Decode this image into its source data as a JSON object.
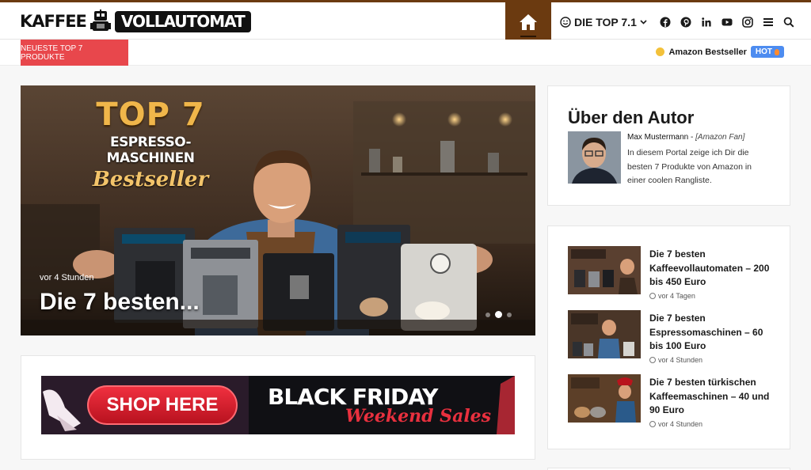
{
  "header": {
    "logo_word1": "KAFFEE",
    "logo_word2": "VOLLAUTOMAT",
    "accent_color": "#6b3a10",
    "menu_label": "DIE TOP 7.1",
    "social_icons": [
      "facebook-icon",
      "pinterest-icon",
      "linkedin-icon",
      "youtube-icon",
      "instagram-icon"
    ],
    "utility_icons": [
      "hamburger-menu-icon",
      "search-icon"
    ]
  },
  "ticker": {
    "label": "NEUESTE TOP 7 PRODUKTE",
    "label_color": "#e8474c",
    "item": "Amazon Bestseller",
    "badge": "HOT"
  },
  "hero": {
    "badge_top": "TOP 7",
    "badge_sub": "ESPRESSO-MASCHINEN",
    "badge_script": "Bestseller",
    "meta": "vor 4 Stunden",
    "title": "Die 7 besten...",
    "slides": 3,
    "active_slide": 2
  },
  "banner": {
    "shop": "SHOP HERE",
    "bf1": "BLACK FRIDAY",
    "bf2": "Weekend Sales"
  },
  "author": {
    "heading": "Über den Autor",
    "name": "Max Mustermann",
    "separator": " - ",
    "role": "[Amazon Fan]",
    "bio": "In diesem Portal zeige ich Dir die besten 7 Produkte von Amazon in einer coolen Rangliste."
  },
  "posts": [
    {
      "title": "Die 7 besten Kaffeevollautomaten – 200 bis 450 Euro",
      "time": "vor 4 Tagen"
    },
    {
      "title": "Die 7 besten Espressomaschinen – 60 bis 100 Euro",
      "time": "vor 4 Stunden"
    },
    {
      "title": "Die 7 besten türkischen Kaffeemaschinen – 40 und 90 Euro",
      "time": "vor 4 Stunden"
    }
  ]
}
